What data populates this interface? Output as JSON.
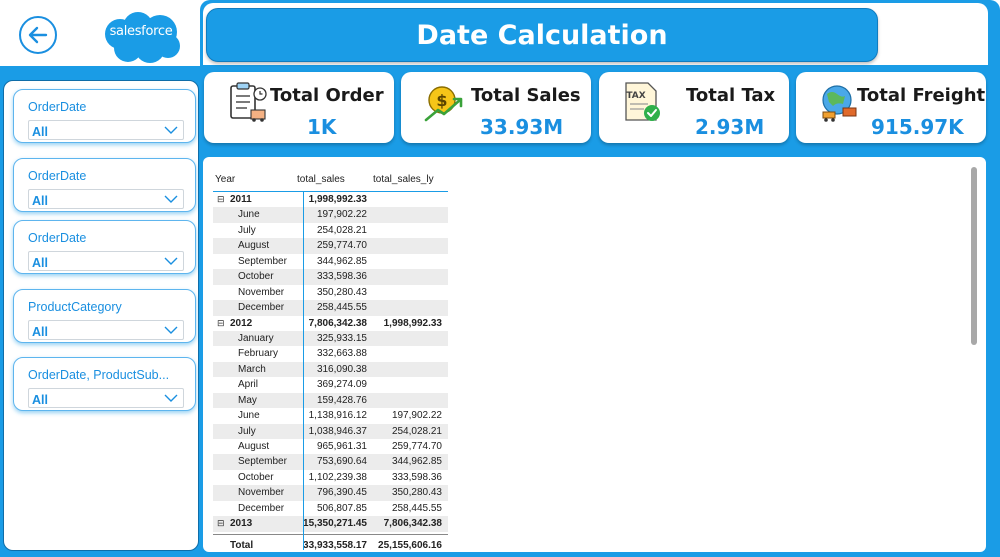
{
  "header": {
    "title": "Date Calculation",
    "logo_text": "salesforce"
  },
  "colors": {
    "accent": "#1a9ce6",
    "value_text": "#1a8fe0",
    "header_border": "#0f7cc0"
  },
  "icons": {
    "back": "back-arrow-icon",
    "order": "clipboard-order-icon",
    "sales": "money-growth-icon",
    "tax": "tax-document-icon",
    "freight": "globe-freight-icon",
    "dropdown": "chevron-down-icon"
  },
  "slicers": [
    {
      "label": "OrderDate",
      "value": "All"
    },
    {
      "label": "OrderDate",
      "value": "All"
    },
    {
      "label": "OrderDate",
      "value": "All"
    },
    {
      "label": "ProductCategory",
      "value": "All"
    },
    {
      "label": "OrderDate, ProductSub...",
      "value": "All"
    }
  ],
  "kpis": [
    {
      "title": "Total Order",
      "value": "1K"
    },
    {
      "title": "Total Sales",
      "value": "33.93M"
    },
    {
      "title": "Total Tax",
      "value": "2.93M"
    },
    {
      "title": "Total Freight",
      "value": "915.97K"
    }
  ],
  "matrix": {
    "columns": [
      "Year",
      "total_sales",
      "total_sales_ly"
    ],
    "expand_symbol": "⊟",
    "rows": [
      {
        "label": "2011",
        "sales": "1,998,992.33",
        "sales_ly": "",
        "level": "year"
      },
      {
        "label": "June",
        "sales": "197,902.22",
        "sales_ly": "",
        "level": "month"
      },
      {
        "label": "July",
        "sales": "254,028.21",
        "sales_ly": "",
        "level": "month"
      },
      {
        "label": "August",
        "sales": "259,774.70",
        "sales_ly": "",
        "level": "month"
      },
      {
        "label": "September",
        "sales": "344,962.85",
        "sales_ly": "",
        "level": "month"
      },
      {
        "label": "October",
        "sales": "333,598.36",
        "sales_ly": "",
        "level": "month"
      },
      {
        "label": "November",
        "sales": "350,280.43",
        "sales_ly": "",
        "level": "month"
      },
      {
        "label": "December",
        "sales": "258,445.55",
        "sales_ly": "",
        "level": "month"
      },
      {
        "label": "2012",
        "sales": "7,806,342.38",
        "sales_ly": "1,998,992.33",
        "level": "year"
      },
      {
        "label": "January",
        "sales": "325,933.15",
        "sales_ly": "",
        "level": "month"
      },
      {
        "label": "February",
        "sales": "332,663.88",
        "sales_ly": "",
        "level": "month"
      },
      {
        "label": "March",
        "sales": "316,090.38",
        "sales_ly": "",
        "level": "month"
      },
      {
        "label": "April",
        "sales": "369,274.09",
        "sales_ly": "",
        "level": "month"
      },
      {
        "label": "May",
        "sales": "159,428.76",
        "sales_ly": "",
        "level": "month"
      },
      {
        "label": "June",
        "sales": "1,138,916.12",
        "sales_ly": "197,902.22",
        "level": "month"
      },
      {
        "label": "July",
        "sales": "1,038,946.37",
        "sales_ly": "254,028.21",
        "level": "month"
      },
      {
        "label": "August",
        "sales": "965,961.31",
        "sales_ly": "259,774.70",
        "level": "month"
      },
      {
        "label": "September",
        "sales": "753,690.64",
        "sales_ly": "344,962.85",
        "level": "month"
      },
      {
        "label": "October",
        "sales": "1,102,239.38",
        "sales_ly": "333,598.36",
        "level": "month"
      },
      {
        "label": "November",
        "sales": "796,390.45",
        "sales_ly": "350,280.43",
        "level": "month"
      },
      {
        "label": "December",
        "sales": "506,807.85",
        "sales_ly": "258,445.55",
        "level": "month"
      },
      {
        "label": "2013",
        "sales": "15,350,271.45",
        "sales_ly": "7,806,342.38",
        "level": "year"
      }
    ],
    "total": {
      "label": "Total",
      "sales": "33,933,558.17",
      "sales_ly": "25,155,606.16"
    }
  }
}
